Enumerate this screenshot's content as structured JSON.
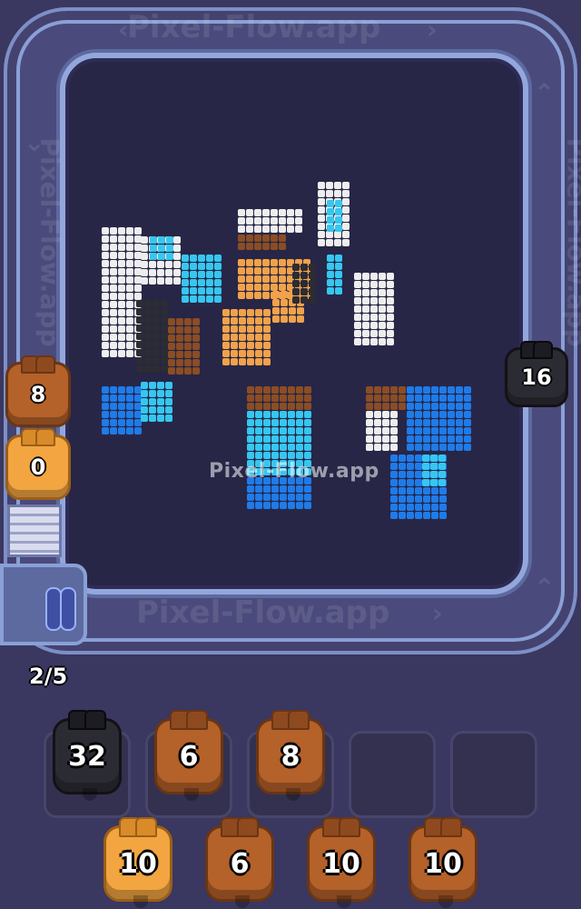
{
  "app": {
    "watermark": "Pixel-Flow.app",
    "watermark_center": "Pixel-Flow.app"
  },
  "track": {
    "shooters": [
      {
        "count": "8",
        "color": "brown"
      },
      {
        "count": "0",
        "color": "orange"
      },
      {
        "count": "16",
        "color": "black"
      }
    ]
  },
  "queue": {
    "counter": "2/5"
  },
  "slots": [
    {
      "count": "32",
      "color": "black"
    },
    {
      "count": "6",
      "color": "brown"
    },
    {
      "count": "8",
      "color": "brown"
    },
    {
      "count": "",
      "color": "empty"
    },
    {
      "count": "",
      "color": "empty"
    }
  ],
  "bottom_row": [
    {
      "count": "10",
      "color": "orange"
    },
    {
      "count": "6",
      "color": "brown"
    },
    {
      "count": "10",
      "color": "brown"
    },
    {
      "count": "10",
      "color": "brown"
    }
  ],
  "colors": {
    "background": "#3a3760",
    "white": "#eeeeee",
    "cyan": "#36c6ef",
    "blue": "#1f7be8",
    "orange": "#f1a24a",
    "brown": "#8b4d23",
    "dark": "#2c2c33"
  }
}
